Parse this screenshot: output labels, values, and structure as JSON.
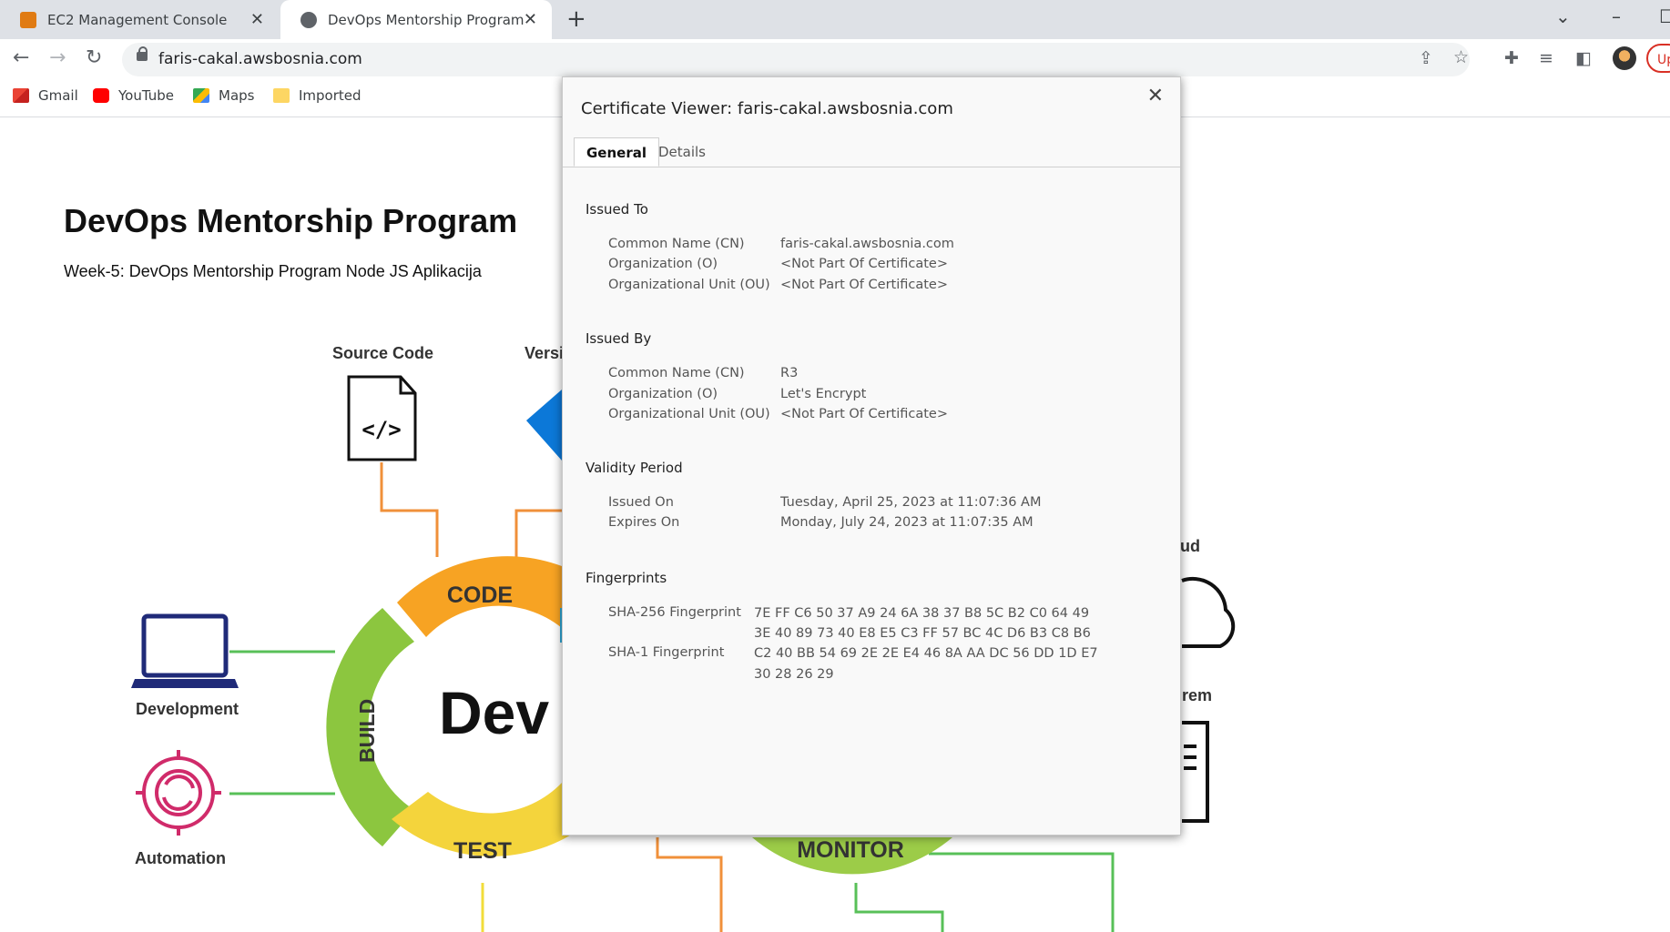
{
  "browser": {
    "tabs": [
      {
        "title": "EC2 Management Console"
      },
      {
        "title": "DevOps Mentorship Program"
      }
    ],
    "url": "faris-cakal.awsbosnia.com",
    "update_label": "Up",
    "bookmarks": [
      "Gmail",
      "YouTube",
      "Maps",
      "Imported"
    ]
  },
  "page": {
    "title": "DevOps Mentorship Program",
    "subtitle": "Week-5: DevOps Mentorship Program Node JS Aplikacija",
    "diagram_labels": {
      "source_code": "Source Code",
      "version": "Versi",
      "development": "Development",
      "automation": "Automation",
      "cloud": "ud",
      "onprem": "rem",
      "code": "CODE",
      "build": "BUILD",
      "test": "TEST",
      "monitor": "MONITOR",
      "center": "Dev"
    }
  },
  "cert": {
    "title": "Certificate Viewer: faris-cakal.awsbosnia.com",
    "tabs": {
      "general": "General",
      "details": "Details"
    },
    "issued_to": {
      "heading": "Issued To",
      "cn_label": "Common Name (CN)",
      "cn": "faris-cakal.awsbosnia.com",
      "o_label": "Organization (O)",
      "o": "<Not Part Of Certificate>",
      "ou_label": "Organizational Unit (OU)",
      "ou": "<Not Part Of Certificate>"
    },
    "issued_by": {
      "heading": "Issued By",
      "cn_label": "Common Name (CN)",
      "cn": "R3",
      "o_label": "Organization (O)",
      "o": "Let's Encrypt",
      "ou_label": "Organizational Unit (OU)",
      "ou": "<Not Part Of Certificate>"
    },
    "validity": {
      "heading": "Validity Period",
      "issued_label": "Issued On",
      "issued": "Tuesday, April 25, 2023 at 11:07:36 AM",
      "expires_label": "Expires On",
      "expires": "Monday, July 24, 2023 at 11:07:35 AM"
    },
    "fingerprints": {
      "heading": "Fingerprints",
      "sha256_label": "SHA-256 Fingerprint",
      "sha256_1": "7E FF C6 50 37 A9 24 6A 38 37 B8 5C B2 C0 64 49",
      "sha256_2": "3E 40 89 73 40 E8 E5 C3 FF 57 BC 4C D6 B3 C8 B6",
      "sha1_label": "SHA-1 Fingerprint",
      "sha1_1": "C2 40 BB 54 69 2E 2E E4 46 8A AA DC 56 DD 1D E7",
      "sha1_2": "30 28 26 29"
    }
  }
}
